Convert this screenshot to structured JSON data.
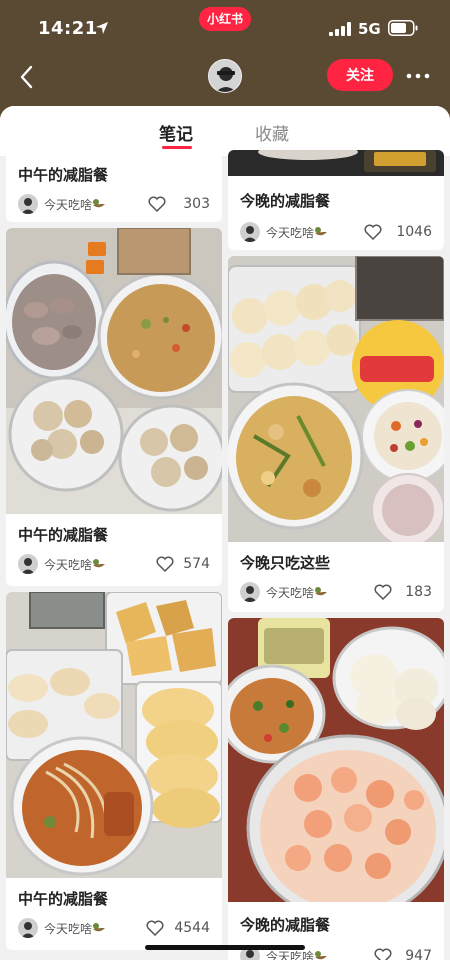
{
  "status": {
    "time": "14:21",
    "app_badge": "小红书",
    "network": "5G"
  },
  "header": {
    "follow_label": "关注",
    "icons": [
      "back-icon",
      "avatar",
      "more-icon"
    ]
  },
  "tabs": [
    {
      "label": "笔记",
      "active": true
    },
    {
      "label": "收藏",
      "active": false
    }
  ],
  "notes": [
    {
      "title": "中午的减脂餐",
      "author": "今天吃啥",
      "likes": "303"
    },
    {
      "title": "今晚的减脂餐",
      "author": "今天吃啥",
      "likes": "1046"
    },
    {
      "title": "中午的减脂餐",
      "author": "今天吃啥",
      "likes": "574"
    },
    {
      "title": "今晚只吃这些",
      "author": "今天吃啥",
      "likes": "183"
    },
    {
      "title": "中午的减脂餐",
      "author": "今天吃啥",
      "likes": "4544"
    },
    {
      "title": "今晚的减脂餐",
      "author": "今天吃啥",
      "likes": "947"
    }
  ],
  "colors": {
    "brand": "#ff2442",
    "header_bg": "#5b4a33",
    "feed_bg": "#f1f1f1"
  }
}
